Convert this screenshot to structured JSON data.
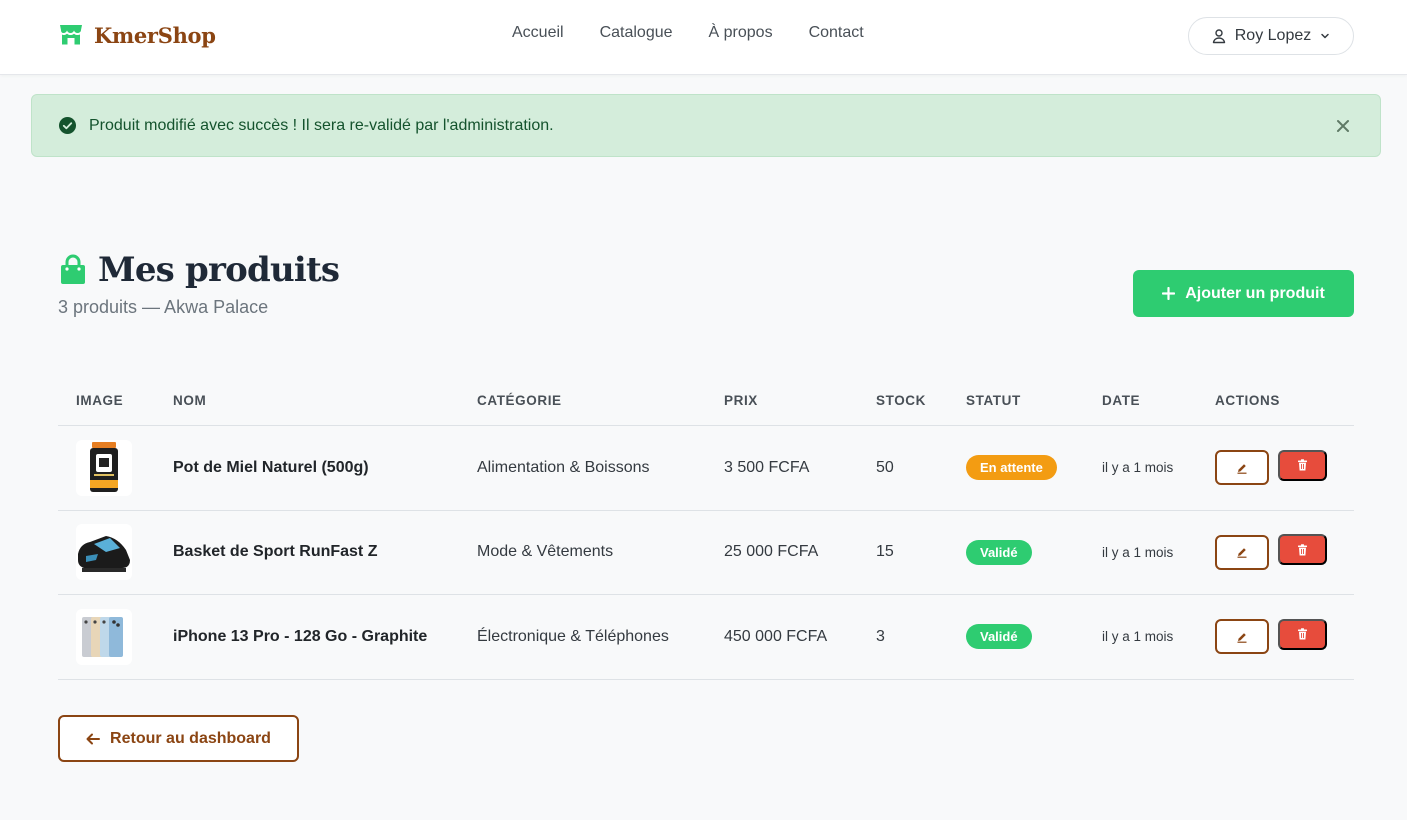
{
  "brand": {
    "name": "KmerShop"
  },
  "nav": {
    "items": [
      "Accueil",
      "Catalogue",
      "À propos",
      "Contact"
    ]
  },
  "user": {
    "name": "Roy Lopez"
  },
  "alert": {
    "message": "Produit modifié avec succès ! Il sera re-validé par l'administration."
  },
  "page": {
    "title": "Mes produits",
    "subtitle": "3 produits — Akwa Palace",
    "add_button": "Ajouter un produit",
    "back_button": "Retour au dashboard"
  },
  "table": {
    "headers": [
      "IMAGE",
      "NOM",
      "CATÉGORIE",
      "PRIX",
      "STOCK",
      "STATUT",
      "DATE",
      "ACTIONS"
    ],
    "rows": [
      {
        "name": "Pot de Miel Naturel (500g)",
        "category": "Alimentation & Boissons",
        "price": "3 500 FCFA",
        "stock": "50",
        "status": "En attente",
        "date": "il y a 1 mois"
      },
      {
        "name": "Basket de Sport RunFast Z",
        "category": "Mode & Vêtements",
        "price": "25 000 FCFA",
        "stock": "15",
        "status": "Validé",
        "date": "il y a 1 mois"
      },
      {
        "name": "iPhone 13 Pro - 128 Go - Graphite",
        "category": "Électronique & Téléphones",
        "price": "450 000 FCFA",
        "stock": "3",
        "status": "Validé",
        "date": "il y a 1 mois"
      }
    ]
  },
  "colors": {
    "brand": "#8b4513",
    "accent": "#2ecc71",
    "pending": "#f39c12",
    "danger": "#e74c3c"
  },
  "icons": [
    "shop-icon",
    "user-icon",
    "chevron-down-icon",
    "check-circle-icon",
    "close-icon",
    "shopping-bag-icon",
    "plus-icon",
    "pencil-icon",
    "trash-icon",
    "arrow-left-icon"
  ]
}
